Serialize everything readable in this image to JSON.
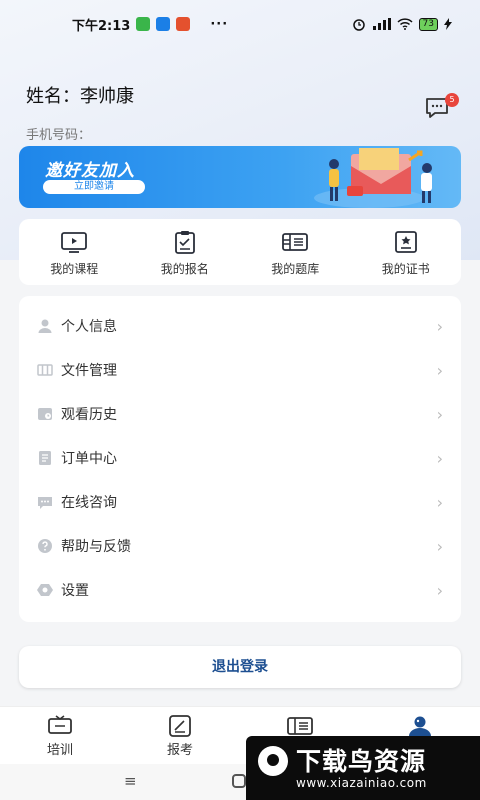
{
  "status_bar": {
    "time": "下午2:13",
    "dots": "···",
    "battery": "73"
  },
  "profile": {
    "name_label": "姓名：",
    "name_value": "李帅康",
    "phone_label": "手机号码："
  },
  "messages": {
    "badge_count": "5"
  },
  "banner": {
    "title": "邀好友加入",
    "button": "立即邀请"
  },
  "quick_actions": [
    {
      "label": "我的课程",
      "icon": "tv-play-icon"
    },
    {
      "label": "我的报名",
      "icon": "clipboard-icon"
    },
    {
      "label": "我的题库",
      "icon": "question-bank-icon"
    },
    {
      "label": "我的证书",
      "icon": "certificate-icon"
    }
  ],
  "menu": [
    {
      "label": "个人信息",
      "icon": "person-icon"
    },
    {
      "label": "文件管理",
      "icon": "folder-icon"
    },
    {
      "label": "观看历史",
      "icon": "history-icon"
    },
    {
      "label": "订单中心",
      "icon": "order-icon"
    },
    {
      "label": "在线咨询",
      "icon": "chat-icon"
    },
    {
      "label": "帮助与反馈",
      "icon": "help-icon"
    },
    {
      "label": "设置",
      "icon": "settings-icon"
    }
  ],
  "logout_label": "退出登录",
  "tabs": [
    {
      "label": "培训",
      "icon": "training-icon"
    },
    {
      "label": "报考",
      "icon": "exam-apply-icon"
    },
    {
      "label": "",
      "icon": "question-bank-icon"
    },
    {
      "label": "",
      "icon": "profile-icon",
      "active": true
    }
  ],
  "nav": {
    "menu_glyph": "≡"
  },
  "watermark": {
    "title": "下载鸟资源",
    "url": "www.xiazainiao.com"
  },
  "colors": {
    "accent": "#1e86ea",
    "logout_text": "#1d4f91",
    "badge": "#e8453c",
    "active_tab": "#1d4f91"
  }
}
